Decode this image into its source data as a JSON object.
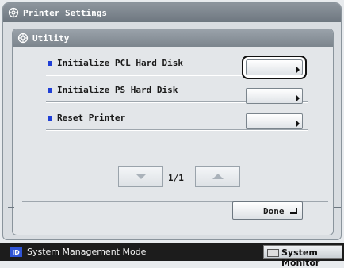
{
  "window": {
    "title": "Printer Settings",
    "title_icon": "gear-icon"
  },
  "panel": {
    "title": "Utility",
    "title_icon": "gear-icon"
  },
  "options": [
    {
      "label": "Initialize PCL Hard Disk",
      "selected": true
    },
    {
      "label": "Initialize PS Hard Disk",
      "selected": false
    },
    {
      "label": "Reset Printer",
      "selected": false
    }
  ],
  "pager": {
    "indicator": "1/1",
    "down_icon": "triangle-down-icon",
    "up_icon": "triangle-up-icon"
  },
  "done_button": {
    "label": "Done",
    "icon": "enter-icon"
  },
  "status_bar": {
    "mode_icon": "ID",
    "mode_text": "System Management Mode",
    "monitor_button": "System Monitor"
  },
  "colors": {
    "bullet": "#1f3fd6",
    "status_bg": "#1c1c1c",
    "title_bg": "#7c858d"
  }
}
